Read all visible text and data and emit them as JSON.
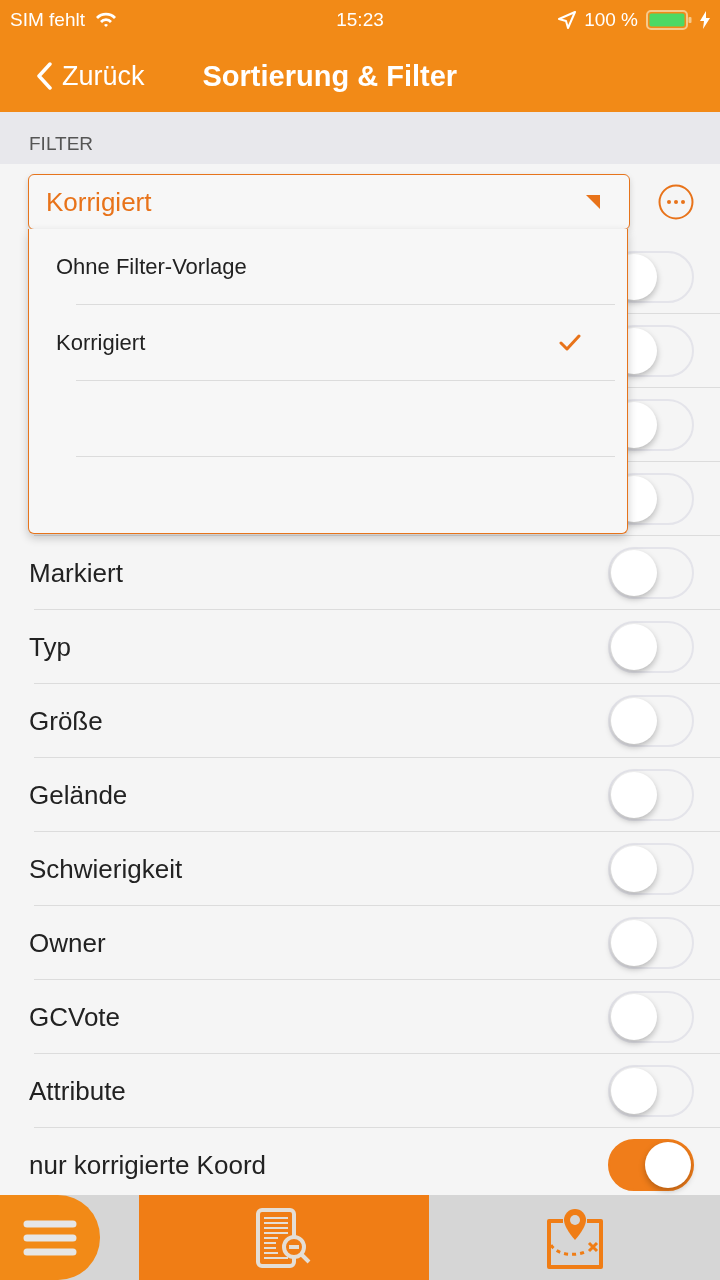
{
  "status_bar": {
    "carrier": "SIM fehlt",
    "time": "15:23",
    "battery": "100 %"
  },
  "nav": {
    "back": "Zurück",
    "title": "Sortierung & Filter"
  },
  "section": {
    "title": "FILTER"
  },
  "filter_preset": {
    "value": "Korrigiert",
    "expanded": true,
    "options": [
      {
        "kind": "option",
        "label": "Ohne Filter-Vorlage",
        "selected": false
      },
      {
        "kind": "option",
        "label": "Korrigiert",
        "selected": true
      },
      {
        "kind": "empty"
      },
      {
        "kind": "empty"
      }
    ]
  },
  "rows": [
    {
      "on": false
    },
    {
      "on": false
    },
    {
      "on": false
    },
    {
      "on": false
    },
    {
      "label": "Markiert",
      "on": false
    },
    {
      "label": "Typ",
      "on": false
    },
    {
      "label": "Größe",
      "on": false
    },
    {
      "label": "Gelände",
      "on": false
    },
    {
      "label": "Schwierigkeit",
      "on": false
    },
    {
      "label": "Owner",
      "on": false
    },
    {
      "label": "GCVote",
      "on": false
    },
    {
      "label": "Attribute",
      "on": false
    },
    {
      "label": "nur korrigierte Koord",
      "on": true
    }
  ],
  "tab_bar": {
    "tabs": [
      {
        "kind": "list",
        "selected": true
      },
      {
        "kind": "map",
        "selected": false
      }
    ]
  }
}
